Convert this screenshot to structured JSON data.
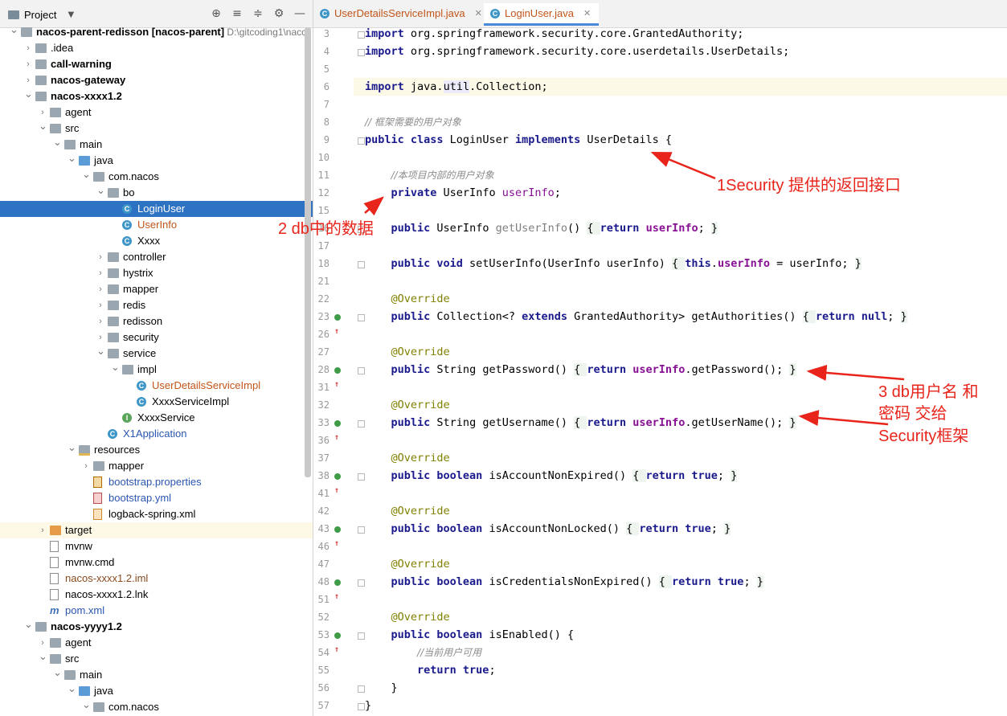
{
  "project_panel": {
    "title": "Project",
    "toolbar_icons": [
      "target-icon",
      "expand-icon",
      "collapse-icon",
      "gear-icon",
      "minimize-icon"
    ],
    "tree": [
      {
        "indent": 0,
        "arrow": "down",
        "icon": "folder",
        "label": "nacos-parent-redisson",
        "suffix": "[nacos-parent]",
        "path": "D:\\gitcoding1\\nacc",
        "bold": true
      },
      {
        "indent": 1,
        "arrow": "right",
        "icon": "folder",
        "label": ".idea"
      },
      {
        "indent": 1,
        "arrow": "right",
        "icon": "folder",
        "label": "call-warning",
        "bold": true
      },
      {
        "indent": 1,
        "arrow": "right",
        "icon": "folder",
        "label": "nacos-gateway",
        "bold": true
      },
      {
        "indent": 1,
        "arrow": "down",
        "icon": "folder",
        "label": "nacos-xxxx1.2",
        "bold": true
      },
      {
        "indent": 2,
        "arrow": "right",
        "icon": "folder",
        "label": "agent"
      },
      {
        "indent": 2,
        "arrow": "down",
        "icon": "folder",
        "label": "src"
      },
      {
        "indent": 3,
        "arrow": "down",
        "icon": "folder",
        "label": "main"
      },
      {
        "indent": 4,
        "arrow": "down",
        "icon": "folder-blue",
        "label": "java"
      },
      {
        "indent": 5,
        "arrow": "down",
        "icon": "folder",
        "label": "com.nacos"
      },
      {
        "indent": 6,
        "arrow": "down",
        "icon": "folder",
        "label": "bo"
      },
      {
        "indent": 7,
        "arrow": "",
        "icon": "class",
        "label": "LoginUser",
        "selected": true,
        "color": "orange"
      },
      {
        "indent": 7,
        "arrow": "",
        "icon": "class",
        "label": "UserInfo",
        "color": "orange"
      },
      {
        "indent": 7,
        "arrow": "",
        "icon": "class",
        "label": "Xxxx"
      },
      {
        "indent": 6,
        "arrow": "right",
        "icon": "folder",
        "label": "controller"
      },
      {
        "indent": 6,
        "arrow": "right",
        "icon": "folder",
        "label": "hystrix"
      },
      {
        "indent": 6,
        "arrow": "right",
        "icon": "folder",
        "label": "mapper"
      },
      {
        "indent": 6,
        "arrow": "right",
        "icon": "folder",
        "label": "redis"
      },
      {
        "indent": 6,
        "arrow": "right",
        "icon": "folder",
        "label": "redisson"
      },
      {
        "indent": 6,
        "arrow": "right",
        "icon": "folder",
        "label": "security"
      },
      {
        "indent": 6,
        "arrow": "down",
        "icon": "folder",
        "label": "service"
      },
      {
        "indent": 7,
        "arrow": "down",
        "icon": "folder",
        "label": "impl"
      },
      {
        "indent": 8,
        "arrow": "",
        "icon": "class",
        "label": "UserDetailsServiceImpl",
        "color": "orange"
      },
      {
        "indent": 8,
        "arrow": "",
        "icon": "class",
        "label": "XxxxServiceImpl"
      },
      {
        "indent": 7,
        "arrow": "",
        "icon": "interface",
        "label": "XxxxService"
      },
      {
        "indent": 6,
        "arrow": "",
        "icon": "class",
        "label": "X1Application",
        "color": "blue"
      },
      {
        "indent": 4,
        "arrow": "down",
        "icon": "folder-res",
        "label": "resources"
      },
      {
        "indent": 5,
        "arrow": "right",
        "icon": "folder",
        "label": "mapper"
      },
      {
        "indent": 5,
        "arrow": "",
        "icon": "props",
        "label": "bootstrap.properties",
        "color": "blue"
      },
      {
        "indent": 5,
        "arrow": "",
        "icon": "yml",
        "label": "bootstrap.yml",
        "color": "blue"
      },
      {
        "indent": 5,
        "arrow": "",
        "icon": "xml",
        "label": "logback-spring.xml"
      },
      {
        "indent": 2,
        "arrow": "right",
        "icon": "folder-orange",
        "label": "target",
        "highlight": true
      },
      {
        "indent": 2,
        "arrow": "",
        "icon": "file",
        "label": "mvnw"
      },
      {
        "indent": 2,
        "arrow": "",
        "icon": "file",
        "label": "mvnw.cmd"
      },
      {
        "indent": 2,
        "arrow": "",
        "icon": "file",
        "label": "nacos-xxxx1.2.iml",
        "color": "brown"
      },
      {
        "indent": 2,
        "arrow": "",
        "icon": "file",
        "label": "nacos-xxxx1.2.lnk"
      },
      {
        "indent": 2,
        "arrow": "",
        "icon": "maven",
        "label": "pom.xml",
        "color": "blue"
      },
      {
        "indent": 1,
        "arrow": "down",
        "icon": "folder",
        "label": "nacos-yyyy1.2",
        "bold": true
      },
      {
        "indent": 2,
        "arrow": "right",
        "icon": "folder",
        "label": "agent"
      },
      {
        "indent": 2,
        "arrow": "down",
        "icon": "folder",
        "label": "src"
      },
      {
        "indent": 3,
        "arrow": "down",
        "icon": "folder",
        "label": "main"
      },
      {
        "indent": 4,
        "arrow": "down",
        "icon": "folder-blue",
        "label": "java"
      },
      {
        "indent": 5,
        "arrow": "down",
        "icon": "folder",
        "label": "com.nacos"
      }
    ]
  },
  "editor": {
    "tabs": [
      {
        "label": "UserDetailsServiceImpl.java",
        "active": false
      },
      {
        "label": "LoginUser.java",
        "active": true
      }
    ],
    "lines": [
      {
        "n": "3",
        "html": "<span class=\"kw\">import</span> org.springframework.security.core.GrantedAuthority;"
      },
      {
        "n": "4",
        "html": "<span class=\"kw\">import</span> org.springframework.security.core.userdetails.UserDetails;"
      },
      {
        "n": "5",
        "html": ""
      },
      {
        "n": "6",
        "html": "<span class=\"kw\">import</span> java.<span class=\"idf\">util</span>.Collection;",
        "hl": true
      },
      {
        "n": "7",
        "html": ""
      },
      {
        "n": "8",
        "html": "<span class=\"cm\">// 框架需要的用户对象</span>"
      },
      {
        "n": "9",
        "html": "<span class=\"kw\">public class</span> LoginUser <span class=\"kw\">implements</span> UserDetails {"
      },
      {
        "n": "10",
        "html": ""
      },
      {
        "n": "11",
        "html": "    <span class=\"cm\">//本项目内部的用户对象</span>"
      },
      {
        "n": "12",
        "html": "    <span class=\"kw\">private</span> UserInfo <span class=\"fld\" style=\"font-weight:normal\">userInfo</span>;"
      },
      {
        "n": "15",
        "html": ""
      },
      {
        "n": "16",
        "html": "    <span class=\"kw\">public</span> UserInfo <span class=\"gr\">getUserInfo</span>() <span class=\"fb\">{ </span><span class=\"kw\">return</span> <span class=\"fld\">userInfo</span>; <span class=\"fb\">}</span>"
      },
      {
        "n": "17",
        "html": ""
      },
      {
        "n": "18",
        "html": "    <span class=\"kw\">public void</span> setUserInfo(UserInfo userInfo) <span class=\"fb\">{ </span><span class=\"kw\">this</span>.<span class=\"fld\">userInfo</span> = userInfo; <span class=\"fb\">}</span>"
      },
      {
        "n": "21",
        "html": ""
      },
      {
        "n": "22",
        "html": "    <span class=\"ann\">@Override</span>"
      },
      {
        "n": "23",
        "html": "    <span class=\"kw\">public</span> Collection&lt;? <span class=\"kw\">extends</span> GrantedAuthority&gt; getAuthorities() <span class=\"fb\">{ </span><span class=\"kw\">return null</span>; <span class=\"fb\">}</span>",
        "mark": true
      },
      {
        "n": "26",
        "html": ""
      },
      {
        "n": "27",
        "html": "    <span class=\"ann\">@Override</span>"
      },
      {
        "n": "28",
        "html": "    <span class=\"kw\">public</span> String getPassword() <span class=\"fb\">{ </span><span class=\"kw\">return</span> <span class=\"fld\">userInfo</span>.getPassword(); <span class=\"fb\">}</span>",
        "mark": true
      },
      {
        "n": "31",
        "html": ""
      },
      {
        "n": "32",
        "html": "    <span class=\"ann\">@Override</span>"
      },
      {
        "n": "33",
        "html": "    <span class=\"kw\">public</span> String getUsername() <span class=\"fb\">{ </span><span class=\"kw\">return</span> <span class=\"fld\">userInfo</span>.getUserName(); <span class=\"fb\">}</span>",
        "mark": true
      },
      {
        "n": "36",
        "html": ""
      },
      {
        "n": "37",
        "html": "    <span class=\"ann\">@Override</span>"
      },
      {
        "n": "38",
        "html": "    <span class=\"kw\">public boolean</span> isAccountNonExpired() <span class=\"fb\">{ </span><span class=\"kw\">return true</span>; <span class=\"fb\">}</span>",
        "mark": true
      },
      {
        "n": "41",
        "html": ""
      },
      {
        "n": "42",
        "html": "    <span class=\"ann\">@Override</span>"
      },
      {
        "n": "43",
        "html": "    <span class=\"kw\">public boolean</span> isAccountNonLocked() <span class=\"fb\">{ </span><span class=\"kw\">return true</span>; <span class=\"fb\">}</span>",
        "mark": true
      },
      {
        "n": "46",
        "html": ""
      },
      {
        "n": "47",
        "html": "    <span class=\"ann\">@Override</span>"
      },
      {
        "n": "48",
        "html": "    <span class=\"kw\">public boolean</span> isCredentialsNonExpired() <span class=\"fb\">{ </span><span class=\"kw\">return true</span>; <span class=\"fb\">}</span>",
        "mark": true
      },
      {
        "n": "51",
        "html": ""
      },
      {
        "n": "52",
        "html": "    <span class=\"ann\">@Override</span>"
      },
      {
        "n": "53",
        "html": "    <span class=\"kw\">public boolean</span> isEnabled() {",
        "mark": true
      },
      {
        "n": "54",
        "html": "        <span class=\"cm\">//当前用户可用</span>"
      },
      {
        "n": "55",
        "html": "        <span class=\"kw\">return true</span>;"
      },
      {
        "n": "56",
        "html": "    }"
      },
      {
        "n": "57",
        "html": "}"
      }
    ]
  },
  "annotations": {
    "note1": "1Security 提供的返回接口",
    "note2": "2 db中的数据",
    "note3_line1": "3 db用户名 和",
    "note3_line2": "密码 交给",
    "note3_line3": "Security框架",
    "color": "#e8241b"
  }
}
